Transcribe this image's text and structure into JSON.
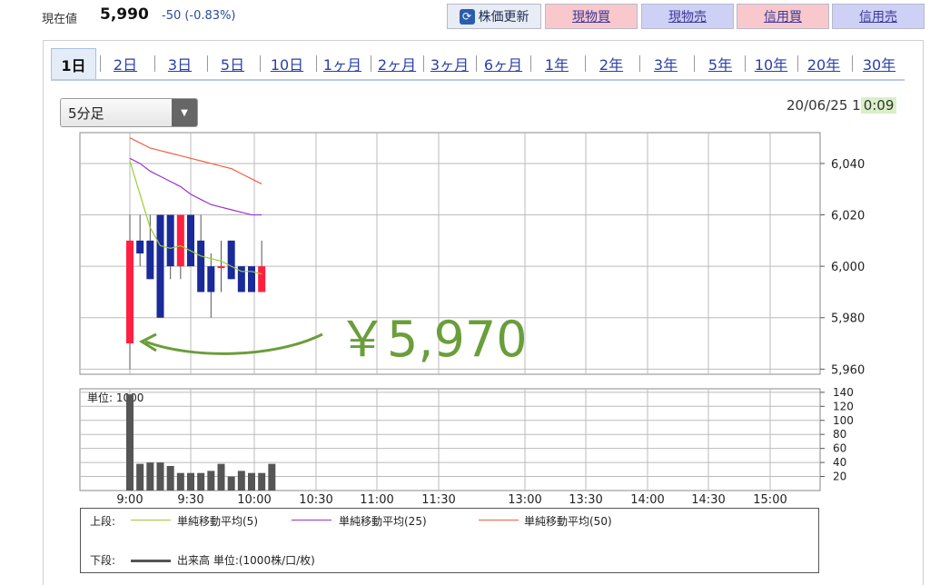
{
  "header": {
    "price_label": "現在値",
    "price_value": "5,990",
    "price_change": "-50 (-0.83%)",
    "refresh_label": "株価更新",
    "buttons": [
      "現物買",
      "現物売",
      "信用買",
      "信用売"
    ]
  },
  "tabs": [
    "1日",
    "2日",
    "3日",
    "5日",
    "10日",
    "1ヶ月",
    "2ヶ月",
    "3ヶ月",
    "6ヶ月",
    "1年",
    "2年",
    "3年",
    "5年",
    "10年",
    "20年",
    "30年"
  ],
  "active_tab": "1日",
  "interval_select": "5分足",
  "datetime": {
    "date": "20/06/25 1",
    "time": "0:09"
  },
  "annotation": {
    "text": "￥5,970",
    "color": "#6a9e3a"
  },
  "colors": {
    "up": "#ff2040",
    "down": "#1a2a9a",
    "ma5": "#9acd32",
    "ma25": "#9b30d0",
    "ma50": "#f06040",
    "volume": "#555555",
    "grid": "#bbbbbb"
  },
  "chart_data": {
    "type": "candlestick",
    "x_ticks": [
      "9:00",
      "9:30",
      "10:00",
      "10:30",
      "11:00",
      "11:30",
      "13:00",
      "13:30",
      "14:00",
      "14:30",
      "15:00"
    ],
    "price_axis": {
      "ticks": [
        "6,040",
        "6,020",
        "6,000",
        "5,980",
        "5,960"
      ],
      "values": [
        6040,
        6020,
        6000,
        5980,
        5960
      ],
      "ylim": [
        5958,
        6052
      ]
    },
    "candles": [
      {
        "time": "9:00",
        "open": 5970,
        "high": 6020,
        "low": 5960,
        "close": 6010
      },
      {
        "time": "9:05",
        "open": 6010,
        "high": 6020,
        "low": 6000,
        "close": 6005
      },
      {
        "time": "9:10",
        "open": 6010,
        "high": 6020,
        "low": 5995,
        "close": 5995
      },
      {
        "time": "9:15",
        "open": 6020,
        "high": 6020,
        "low": 5980,
        "close": 5980
      },
      {
        "time": "9:20",
        "open": 6020,
        "high": 6020,
        "low": 5995,
        "close": 6000
      },
      {
        "time": "9:25",
        "open": 6000,
        "high": 6020,
        "low": 5995,
        "close": 6020
      },
      {
        "time": "9:30",
        "open": 6020,
        "high": 6020,
        "low": 6000,
        "close": 6000
      },
      {
        "time": "9:35",
        "open": 6010,
        "high": 6020,
        "low": 5990,
        "close": 5990
      },
      {
        "time": "9:40",
        "open": 6000,
        "high": 6005,
        "low": 5980,
        "close": 5990
      },
      {
        "time": "9:45",
        "open": 6000,
        "high": 6010,
        "low": 5990,
        "close": 6000
      },
      {
        "time": "9:50",
        "open": 6010,
        "high": 6010,
        "low": 5995,
        "close": 5995
      },
      {
        "time": "9:55",
        "open": 6000,
        "high": 6000,
        "low": 5990,
        "close": 5990
      },
      {
        "time": "10:00",
        "open": 6000,
        "high": 6000,
        "low": 5990,
        "close": 5990
      },
      {
        "time": "10:05",
        "open": 5990,
        "high": 6010,
        "low": 5990,
        "close": 6000
      }
    ],
    "ma5": [
      6041,
      6028,
      6015,
      6008,
      6007,
      6008,
      6006,
      6004,
      6003,
      6002,
      6000,
      5998,
      5998,
      5997
    ],
    "ma25": [
      6042,
      6040,
      6037,
      6035,
      6033,
      6031,
      6028,
      6026,
      6024,
      6023,
      6022,
      6021,
      6020,
      6020
    ],
    "ma50": [
      6050,
      6048,
      6046,
      6045,
      6044,
      6043,
      6042,
      6041,
      6040,
      6039,
      6038,
      6036,
      6034,
      6032
    ],
    "volume_axis": {
      "label": "単位: 1000",
      "ticks": [
        "140",
        "120",
        "100",
        "80",
        "60",
        "40",
        "20"
      ],
      "values": [
        140,
        120,
        100,
        80,
        60,
        40,
        20
      ],
      "ylim": [
        0,
        145
      ]
    },
    "volume": [
      137,
      38,
      40,
      40,
      35,
      25,
      25,
      25,
      28,
      38,
      20,
      28,
      25,
      25,
      38
    ]
  },
  "legend": {
    "upper_label": "上段:",
    "lower_label": "下段:",
    "ma5": "単純移動平均(5)",
    "ma25": "単純移動平均(25)",
    "ma50": "単純移動平均(50)",
    "volume": "出来高 単位:(1000株/口/枚)"
  }
}
